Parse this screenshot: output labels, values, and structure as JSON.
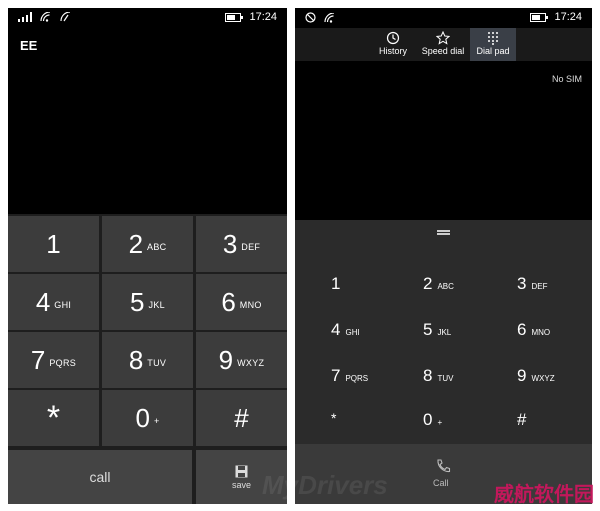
{
  "left_phone": {
    "time": "17:24",
    "carrier": "EE",
    "keys": [
      {
        "digit": "1",
        "letters": ""
      },
      {
        "digit": "2",
        "letters": "ABC"
      },
      {
        "digit": "3",
        "letters": "DEF"
      },
      {
        "digit": "4",
        "letters": "GHI"
      },
      {
        "digit": "5",
        "letters": "JKL"
      },
      {
        "digit": "6",
        "letters": "MNO"
      },
      {
        "digit": "7",
        "letters": "PQRS"
      },
      {
        "digit": "8",
        "letters": "TUV"
      },
      {
        "digit": "9",
        "letters": "WXYZ"
      },
      {
        "digit": "*",
        "letters": ""
      },
      {
        "digit": "0",
        "letters": "+"
      },
      {
        "digit": "#",
        "letters": ""
      }
    ],
    "call_label": "call",
    "save_label": "save",
    "battery_level": 0.6
  },
  "right_phone": {
    "time": "17:24",
    "tabs": [
      {
        "label": "History",
        "icon": "history-icon"
      },
      {
        "label": "Speed dial",
        "icon": "star-icon"
      },
      {
        "label": "Dial pad",
        "icon": "dialpad-icon"
      }
    ],
    "active_tab": "Dial pad",
    "no_sim": "No SIM",
    "keys": [
      {
        "digit": "1",
        "letters": ""
      },
      {
        "digit": "2",
        "letters": "ABC"
      },
      {
        "digit": "3",
        "letters": "DEF"
      },
      {
        "digit": "4",
        "letters": "GHI"
      },
      {
        "digit": "5",
        "letters": "JKL"
      },
      {
        "digit": "6",
        "letters": "MNO"
      },
      {
        "digit": "7",
        "letters": "PQRS"
      },
      {
        "digit": "8",
        "letters": "TUV"
      },
      {
        "digit": "9",
        "letters": "WXYZ"
      },
      {
        "digit": "*",
        "letters": ""
      },
      {
        "digit": "0",
        "letters": "+"
      },
      {
        "digit": "#",
        "letters": ""
      }
    ],
    "call_label": "Call",
    "battery_level": 0.6
  },
  "watermark_cn": "威航软件园",
  "watermark_faint": "MyDrivers",
  "colors": {
    "key_bg": "#3c3c3c",
    "keypad_bg": "#1e1e1e",
    "active_tab": "#3a3f47",
    "watermark": "#c2185b"
  }
}
